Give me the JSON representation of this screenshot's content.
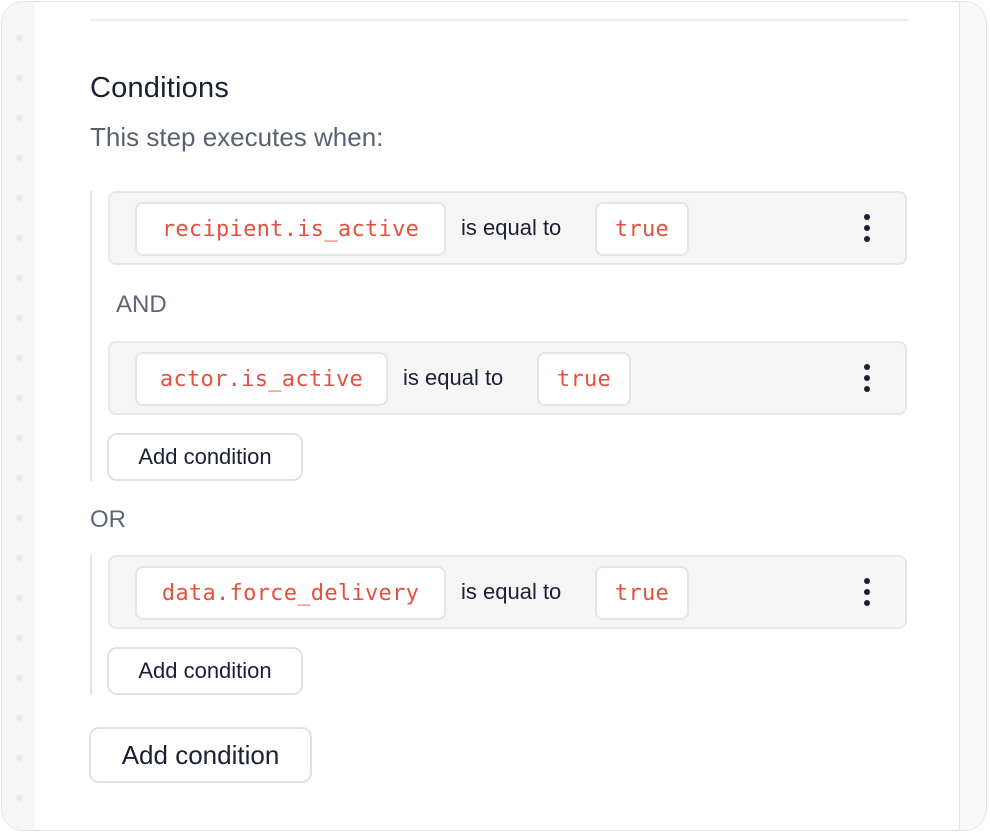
{
  "section": {
    "title": "Conditions",
    "subtitle": "This step executes when:"
  },
  "groups": [
    {
      "conditions": [
        {
          "variable": "recipient.is_active",
          "operator": "is equal to",
          "value": "true"
        },
        {
          "variable": "actor.is_active",
          "operator": "is equal to",
          "value": "true"
        }
      ],
      "joiner": "AND",
      "add_label": "Add condition"
    },
    {
      "conditions": [
        {
          "variable": "data.force_delivery",
          "operator": "is equal to",
          "value": "true"
        }
      ],
      "add_label": "Add condition"
    }
  ],
  "group_joiner": "OR",
  "add_condition_label": "Add condition",
  "icons": {
    "row_menu": "more-vertical-icon"
  },
  "colors": {
    "variable_text": "#e5503f",
    "title_text": "#1a1f36",
    "muted_text": "#5d6678"
  }
}
